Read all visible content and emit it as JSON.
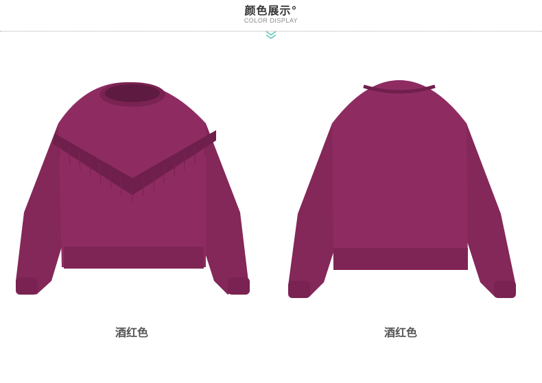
{
  "header": {
    "title": "颜色展示°",
    "subtitle": "COLOR DISPLAY"
  },
  "products": [
    {
      "caption": "酒红色",
      "view": "front"
    },
    {
      "caption": "酒红色",
      "view": "back"
    }
  ],
  "colors": {
    "sweater": "#8a2a5f",
    "sweater_shadow": "#6f1f4b",
    "accent_teal": "#5bbfb5"
  }
}
